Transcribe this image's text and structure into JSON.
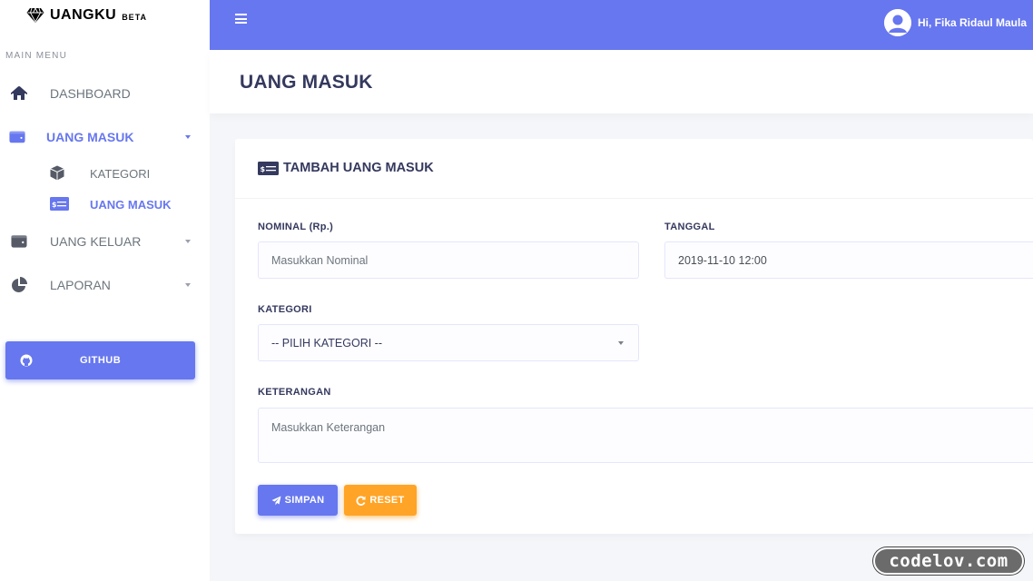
{
  "brand": {
    "name": "UANGKU",
    "badge": "BETA",
    "icon": "diamond-icon"
  },
  "sidebar": {
    "menu_header": "MAIN MENU",
    "items": [
      {
        "label": "DASHBOARD",
        "icon": "home-icon"
      },
      {
        "label": "UANG MASUK",
        "icon": "wallet-icon",
        "active": true,
        "expanded": true,
        "children": [
          {
            "label": "KATEGORI",
            "icon": "cube-icon"
          },
          {
            "label": "UANG MASUK",
            "icon": "money-bill-icon",
            "active": true
          }
        ]
      },
      {
        "label": "UANG KELUAR",
        "icon": "wallet-icon"
      },
      {
        "label": "LAPORAN",
        "icon": "pie-chart-icon"
      }
    ],
    "github_button": {
      "label": "GITHUB",
      "icon": "github-icon"
    }
  },
  "navbar": {
    "user_greeting": "Hi, Fika Ridaul Maula"
  },
  "section": {
    "title": "UANG MASUK"
  },
  "card": {
    "title": "TAMBAH UANG MASUK",
    "fields": {
      "nominal": {
        "label": "NOMINAL (Rp.)",
        "placeholder": "Masukkan Nominal"
      },
      "tanggal": {
        "label": "TANGGAL",
        "value": "2019-11-10 12:00"
      },
      "kategori": {
        "label": "KATEGORI",
        "selected": "-- PILIH KATEGORI --"
      },
      "keterangan": {
        "label": "KETERANGAN",
        "placeholder": "Masukkan Keterangan"
      }
    },
    "buttons": {
      "save": "SIMPAN",
      "reset": "RESET"
    }
  },
  "watermark": "codelov.com",
  "colors": {
    "primary": "#6777ef",
    "warning": "#ffa426",
    "text_dark": "#34395e",
    "muted": "#6c757d",
    "background": "#f4f6f9"
  }
}
